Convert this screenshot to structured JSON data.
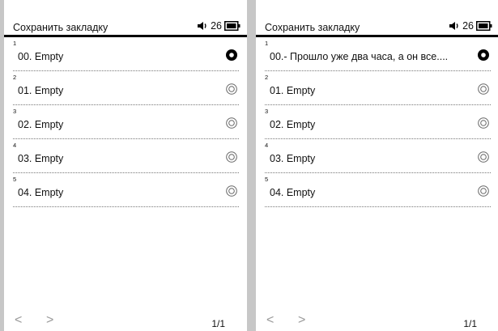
{
  "screens": [
    {
      "title": "Сохранить закладку",
      "volume": "26",
      "rows": [
        {
          "num": "1",
          "label": "00. Empty",
          "selected": true
        },
        {
          "num": "2",
          "label": "01. Empty",
          "selected": false
        },
        {
          "num": "3",
          "label": "02. Empty",
          "selected": false
        },
        {
          "num": "4",
          "label": "03. Empty",
          "selected": false
        },
        {
          "num": "5",
          "label": "04. Empty",
          "selected": false
        }
      ],
      "pager": {
        "prev": "<",
        "next": ">",
        "page": "1/1"
      }
    },
    {
      "title": "Сохранить закладку",
      "volume": "26",
      "rows": [
        {
          "num": "1",
          "label": "00.- Прошло уже два часа, а он все....",
          "selected": true
        },
        {
          "num": "2",
          "label": "01. Empty",
          "selected": false
        },
        {
          "num": "3",
          "label": "02. Empty",
          "selected": false
        },
        {
          "num": "4",
          "label": "03. Empty",
          "selected": false
        },
        {
          "num": "5",
          "label": "04. Empty",
          "selected": false
        }
      ],
      "pager": {
        "prev": "<",
        "next": ">",
        "page": "1/1"
      }
    }
  ],
  "icons": {
    "volume": "speaker-icon",
    "battery": "battery-icon",
    "radio_on": "radio-selected-icon",
    "radio_off": "radio-unselected-icon"
  }
}
